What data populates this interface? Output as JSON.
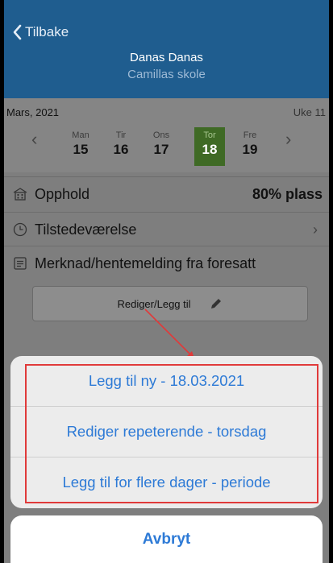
{
  "header": {
    "back_label": "Tilbake",
    "child_name": "Danas Danas",
    "school": "Camillas skole"
  },
  "calendar": {
    "month": "Mars, 2021",
    "week": "Uke 11",
    "days": [
      {
        "name": "Man",
        "date": "15"
      },
      {
        "name": "Tir",
        "date": "16"
      },
      {
        "name": "Ons",
        "date": "17"
      },
      {
        "name": "Tor",
        "date": "18"
      },
      {
        "name": "Fre",
        "date": "19"
      }
    ],
    "selected_index": 3
  },
  "rows": {
    "opphold": {
      "label": "Opphold",
      "value": "80% plass"
    },
    "tilstede": {
      "label": "Tilstedeværelse"
    },
    "merknad": {
      "label": "Merknad/hentemelding fra foresatt"
    }
  },
  "edit_button": {
    "label": "Rediger/Legg til"
  },
  "action_sheet": {
    "items": [
      "Legg til ny - 18.03.2021",
      "Rediger repeterende - torsdag",
      "Legg til for flere dager - periode"
    ],
    "cancel": "Avbryt"
  },
  "colors": {
    "header_bg": "#1f5d8f",
    "selected_day": "#3f6a25",
    "action_blue": "#2d7ad6",
    "annotation_red": "#e03a3a"
  }
}
